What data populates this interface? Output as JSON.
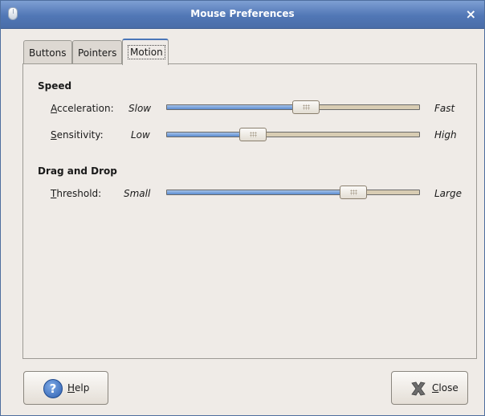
{
  "window": {
    "title": "Mouse Preferences",
    "close_glyph": "×",
    "icon": "mouse-icon"
  },
  "tabs": [
    {
      "label": "Buttons",
      "active": false
    },
    {
      "label": "Pointers",
      "active": false
    },
    {
      "label": "Motion",
      "active": true
    }
  ],
  "speed": {
    "title": "Speed",
    "acceleration": {
      "mnemonic": "A",
      "rest": "cceleration:",
      "min_label": "Slow",
      "max_label": "Fast",
      "level": 0.55
    },
    "sensitivity": {
      "mnemonic": "S",
      "rest": "ensitivity:",
      "min_label": "Low",
      "max_label": "High",
      "level": 0.34
    }
  },
  "dragdrop": {
    "title": "Drag and Drop",
    "threshold": {
      "mnemonic": "T",
      "rest": "hreshold:",
      "min_label": "Small",
      "max_label": "Large",
      "level": 0.74
    }
  },
  "buttons": {
    "help": {
      "mnemonic": "H",
      "rest": "elp",
      "icon": "help-icon"
    },
    "close": {
      "mnemonic": "C",
      "rest": "lose",
      "icon": "close-icon"
    }
  },
  "colors": {
    "titlebar": "#5177b6",
    "slider_fill": "#5a8bd0",
    "slider_track": "#d8ccb3",
    "background": "#efebe7"
  }
}
